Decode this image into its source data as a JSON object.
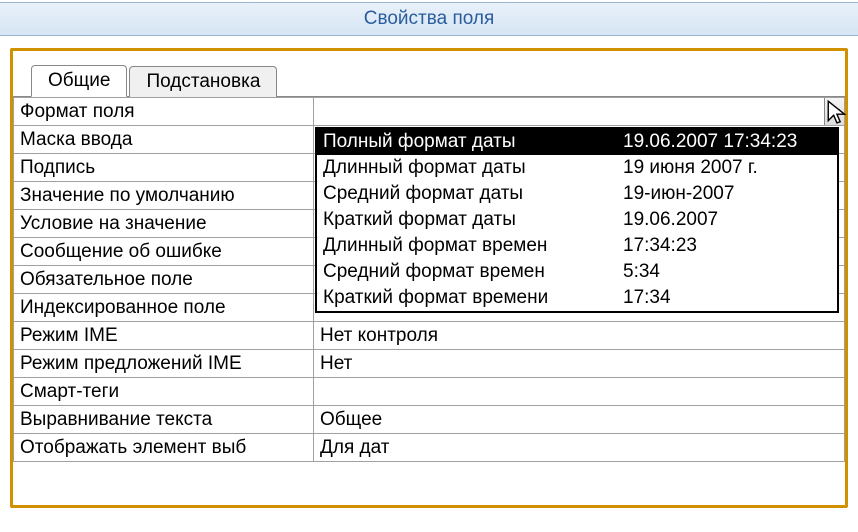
{
  "header": {
    "title": "Свойства поля"
  },
  "tabs": {
    "general": "Общие",
    "lookup": "Подстановка",
    "active": "general"
  },
  "rows": [
    {
      "label": "Формат поля",
      "value": "",
      "hasDropdown": true
    },
    {
      "label": "Маска ввода",
      "value": ""
    },
    {
      "label": "Подпись",
      "value": ""
    },
    {
      "label": "Значение по умолчанию",
      "value": ""
    },
    {
      "label": "Условие на значение",
      "value": ""
    },
    {
      "label": "Сообщение об ошибке",
      "value": ""
    },
    {
      "label": "Обязательное поле",
      "value": ""
    },
    {
      "label": "Индексированное поле",
      "value": ""
    },
    {
      "label": "Режим IME",
      "value": "Нет контроля"
    },
    {
      "label": "Режим предложений IME",
      "value": "Нет"
    },
    {
      "label": "Смарт-теги",
      "value": ""
    },
    {
      "label": "Выравнивание текста",
      "value": "Общее"
    },
    {
      "label": "Отображать элемент выб",
      "value": "Для дат"
    }
  ],
  "dropdown": {
    "selectedIndex": 0,
    "options": [
      {
        "name": "Полный формат даты",
        "example": "19.06.2007 17:34:23"
      },
      {
        "name": "Длинный формат даты",
        "example": "19 июня 2007 г."
      },
      {
        "name": "Средний формат даты",
        "example": "19-июн-2007"
      },
      {
        "name": "Краткий формат даты",
        "example": "19.06.2007"
      },
      {
        "name": "Длинный формат времен",
        "example": "17:34:23"
      },
      {
        "name": "Средний формат времен",
        "example": "5:34"
      },
      {
        "name": "Краткий формат времени",
        "example": "17:34"
      }
    ]
  }
}
